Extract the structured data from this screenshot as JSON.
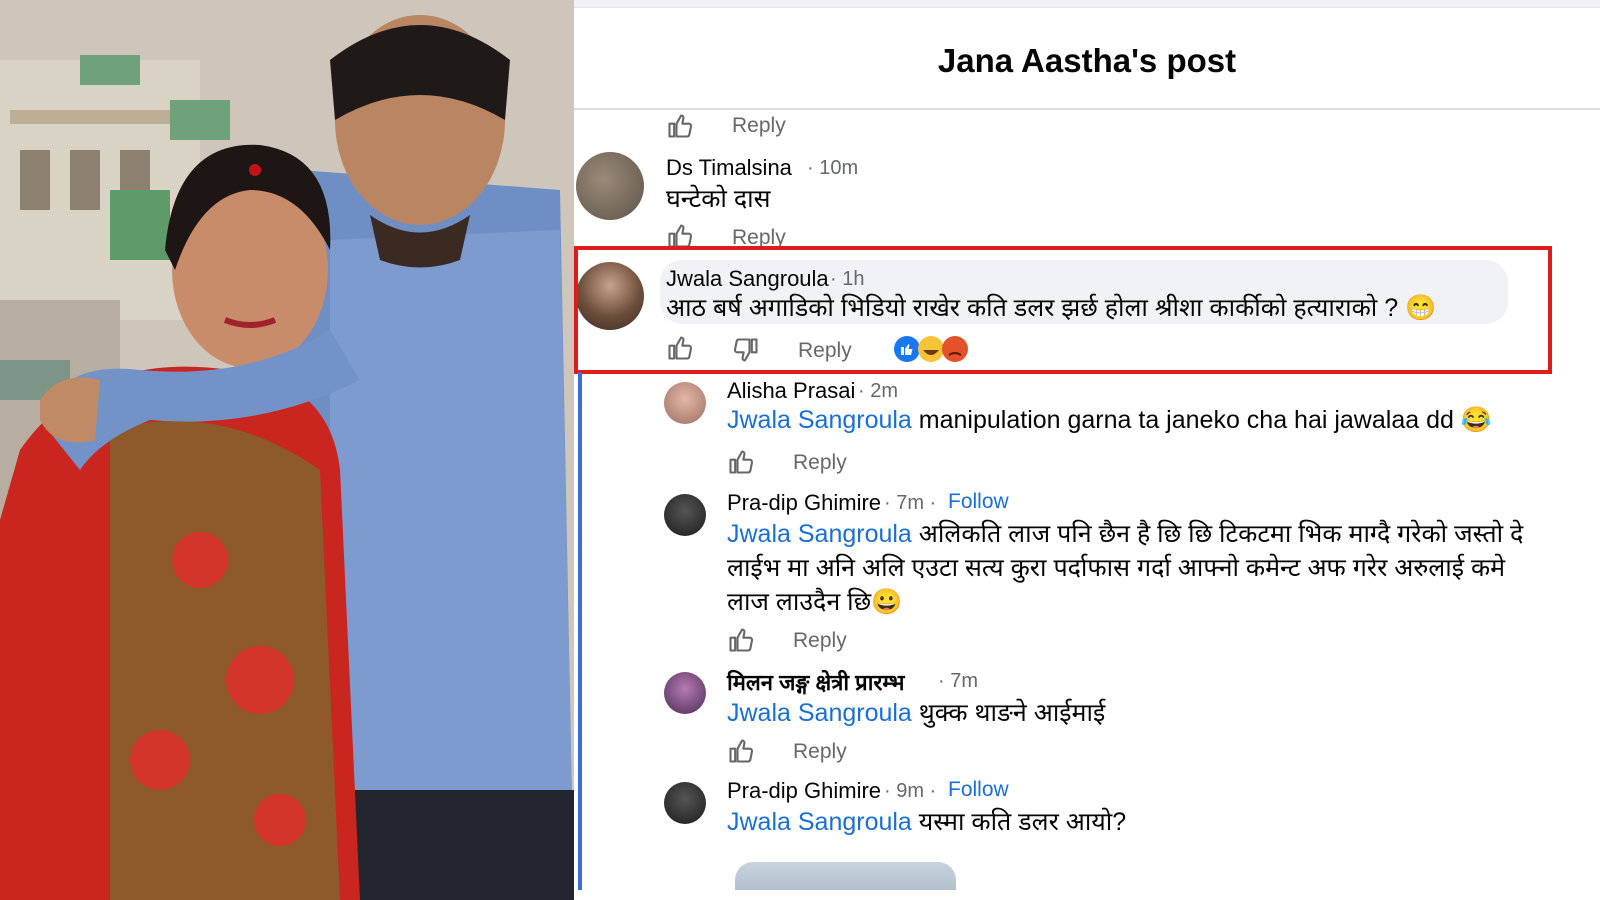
{
  "post": {
    "title": "Jana Aastha's post"
  },
  "labels": {
    "reply": "Reply",
    "follow": "Follow"
  },
  "comments": [
    {
      "name": "Ds Timalsina",
      "time": "· 10m",
      "text": "घन्टेको दास"
    },
    {
      "name": "Jwala Sangroula",
      "time": "· 1h",
      "text": "आठ बर्ष अगाडिको भिडियो राखेर कति डलर झर्छ होला श्रीशा कार्कीको हत्याराको ?",
      "emoji": "😁",
      "reactions": [
        "like",
        "haha",
        "angry"
      ]
    },
    {
      "name": "Alisha Prasai",
      "time": "· 2m",
      "mention": "Jwala Sangroula",
      "text": " manipulation garna ta janeko cha hai jawalaa dd",
      "emoji": "😂"
    },
    {
      "name": "Pra-dip Ghimire",
      "time": "· 7m ·",
      "mention": "Jwala Sangroula",
      "line1": " अलिकति लाज पनि छैन है छि छि टिकटमा भिक माग्दै गरेको जस्तो दे",
      "line2": "लाईभ मा अनि अलि एउटा सत्य कुरा पर्दाफास गर्दा आफ्नो कमेन्ट अफ गरेर अरुलाई कमे",
      "line3": "लाज लाउदैन छि",
      "emoji": "😀"
    },
    {
      "name": "मिलन जङ्ग क्षेत्री प्रारम्भ",
      "time": "· 7m",
      "mention": "Jwala Sangroula",
      "text": " थुक्क थाङने आईमाई"
    },
    {
      "name": "Pra-dip Ghimire",
      "time": "· 9m ·",
      "mention": "Jwala Sangroula",
      "text": " यस्मा कति डलर आयो?"
    }
  ],
  "colors": {
    "highlight_border": "#e01b1b",
    "mention": "#1a6ed8",
    "thread_line": "#3b6fd8"
  }
}
